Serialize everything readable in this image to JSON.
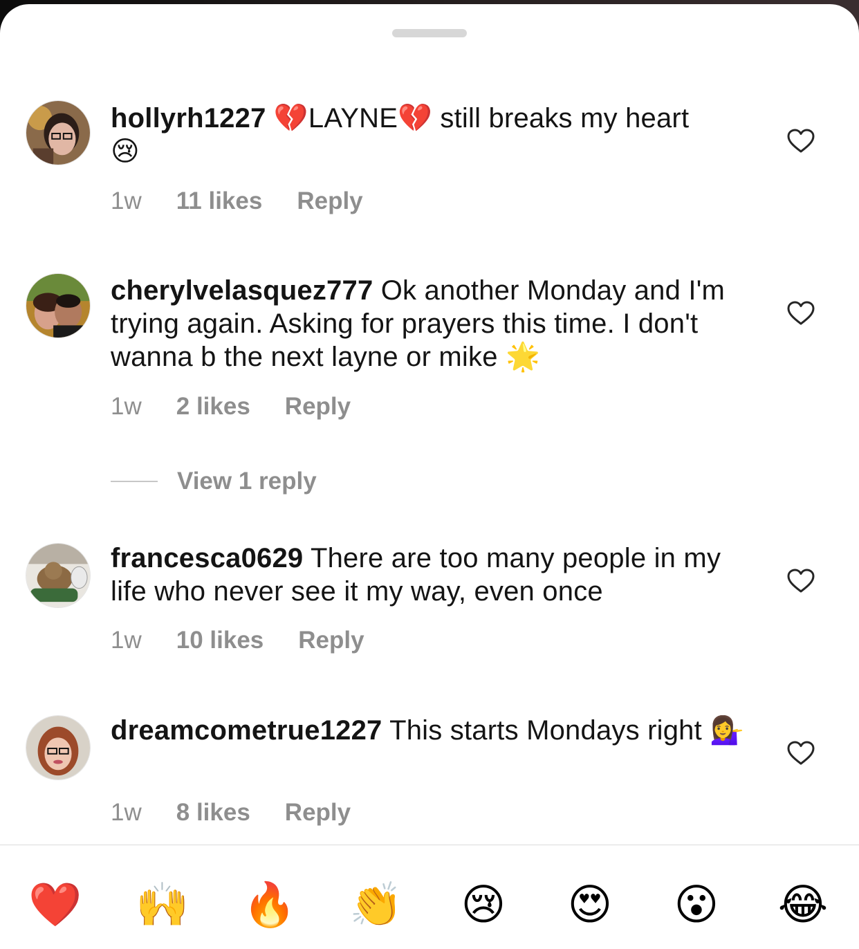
{
  "comments": [
    {
      "username": "hollyrh1227",
      "text_parts": [
        " ",
        "💔",
        "LAYNE",
        "💔",
        " still breaks my heart",
        "😢"
      ],
      "time": "1w",
      "likes": "11 likes",
      "reply": "Reply"
    },
    {
      "username": "cherylvelasquez777",
      "text": " Ok another Monday and I'm trying again. Asking for prayers this time. I don't wanna b the next layne or mike ",
      "emoji": "🌟",
      "time": "1w",
      "likes": "2 likes",
      "reply": "Reply",
      "view_replies": "View 1 reply"
    },
    {
      "username": "francesca0629",
      "text": " There are too many people in my life who never see it my way, even once",
      "time": "1w",
      "likes": "10 likes",
      "reply": "Reply"
    },
    {
      "username": "dreamcometrue1227",
      "text": " This starts Mondays right ",
      "emoji": "💁‍♀️",
      "time": "1w",
      "likes": "8 likes",
      "reply": "Reply"
    }
  ],
  "reactions": [
    {
      "emoji": "❤️",
      "icon": "red-heart-icon"
    },
    {
      "emoji": "🙌",
      "icon": "raising-hands-icon"
    },
    {
      "emoji": "🔥",
      "icon": "fire-icon"
    },
    {
      "emoji": "👏",
      "icon": "clapping-hands-icon"
    },
    {
      "emoji": "😢",
      "icon": "crying-face-icon"
    },
    {
      "emoji": "😍",
      "icon": "heart-eyes-icon"
    },
    {
      "emoji": "😮",
      "icon": "surprised-face-icon"
    },
    {
      "emoji": "😂",
      "icon": "tears-of-joy-icon"
    }
  ],
  "colors": {
    "text": "#141414",
    "meta": "#8e8e8e",
    "divider": "#dbdbdb",
    "grabber": "#d7d7d7"
  }
}
